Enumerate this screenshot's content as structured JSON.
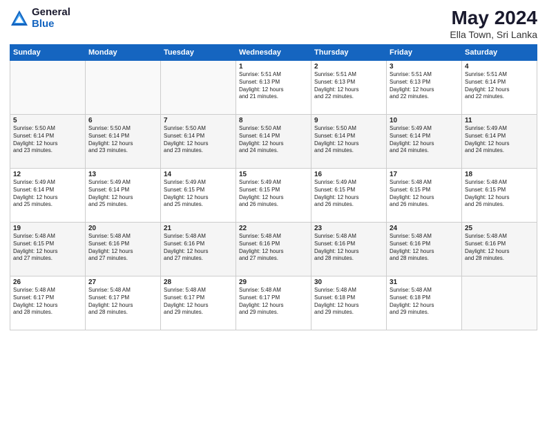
{
  "logo": {
    "general": "General",
    "blue": "Blue"
  },
  "title": "May 2024",
  "subtitle": "Ella Town, Sri Lanka",
  "header_days": [
    "Sunday",
    "Monday",
    "Tuesday",
    "Wednesday",
    "Thursday",
    "Friday",
    "Saturday"
  ],
  "weeks": [
    [
      {
        "day": "",
        "info": ""
      },
      {
        "day": "",
        "info": ""
      },
      {
        "day": "",
        "info": ""
      },
      {
        "day": "1",
        "info": "Sunrise: 5:51 AM\nSunset: 6:13 PM\nDaylight: 12 hours\nand 21 minutes."
      },
      {
        "day": "2",
        "info": "Sunrise: 5:51 AM\nSunset: 6:13 PM\nDaylight: 12 hours\nand 22 minutes."
      },
      {
        "day": "3",
        "info": "Sunrise: 5:51 AM\nSunset: 6:13 PM\nDaylight: 12 hours\nand 22 minutes."
      },
      {
        "day": "4",
        "info": "Sunrise: 5:51 AM\nSunset: 6:14 PM\nDaylight: 12 hours\nand 22 minutes."
      }
    ],
    [
      {
        "day": "5",
        "info": "Sunrise: 5:50 AM\nSunset: 6:14 PM\nDaylight: 12 hours\nand 23 minutes."
      },
      {
        "day": "6",
        "info": "Sunrise: 5:50 AM\nSunset: 6:14 PM\nDaylight: 12 hours\nand 23 minutes."
      },
      {
        "day": "7",
        "info": "Sunrise: 5:50 AM\nSunset: 6:14 PM\nDaylight: 12 hours\nand 23 minutes."
      },
      {
        "day": "8",
        "info": "Sunrise: 5:50 AM\nSunset: 6:14 PM\nDaylight: 12 hours\nand 24 minutes."
      },
      {
        "day": "9",
        "info": "Sunrise: 5:50 AM\nSunset: 6:14 PM\nDaylight: 12 hours\nand 24 minutes."
      },
      {
        "day": "10",
        "info": "Sunrise: 5:49 AM\nSunset: 6:14 PM\nDaylight: 12 hours\nand 24 minutes."
      },
      {
        "day": "11",
        "info": "Sunrise: 5:49 AM\nSunset: 6:14 PM\nDaylight: 12 hours\nand 24 minutes."
      }
    ],
    [
      {
        "day": "12",
        "info": "Sunrise: 5:49 AM\nSunset: 6:14 PM\nDaylight: 12 hours\nand 25 minutes."
      },
      {
        "day": "13",
        "info": "Sunrise: 5:49 AM\nSunset: 6:14 PM\nDaylight: 12 hours\nand 25 minutes."
      },
      {
        "day": "14",
        "info": "Sunrise: 5:49 AM\nSunset: 6:15 PM\nDaylight: 12 hours\nand 25 minutes."
      },
      {
        "day": "15",
        "info": "Sunrise: 5:49 AM\nSunset: 6:15 PM\nDaylight: 12 hours\nand 26 minutes."
      },
      {
        "day": "16",
        "info": "Sunrise: 5:49 AM\nSunset: 6:15 PM\nDaylight: 12 hours\nand 26 minutes."
      },
      {
        "day": "17",
        "info": "Sunrise: 5:48 AM\nSunset: 6:15 PM\nDaylight: 12 hours\nand 26 minutes."
      },
      {
        "day": "18",
        "info": "Sunrise: 5:48 AM\nSunset: 6:15 PM\nDaylight: 12 hours\nand 26 minutes."
      }
    ],
    [
      {
        "day": "19",
        "info": "Sunrise: 5:48 AM\nSunset: 6:15 PM\nDaylight: 12 hours\nand 27 minutes."
      },
      {
        "day": "20",
        "info": "Sunrise: 5:48 AM\nSunset: 6:16 PM\nDaylight: 12 hours\nand 27 minutes."
      },
      {
        "day": "21",
        "info": "Sunrise: 5:48 AM\nSunset: 6:16 PM\nDaylight: 12 hours\nand 27 minutes."
      },
      {
        "day": "22",
        "info": "Sunrise: 5:48 AM\nSunset: 6:16 PM\nDaylight: 12 hours\nand 27 minutes."
      },
      {
        "day": "23",
        "info": "Sunrise: 5:48 AM\nSunset: 6:16 PM\nDaylight: 12 hours\nand 28 minutes."
      },
      {
        "day": "24",
        "info": "Sunrise: 5:48 AM\nSunset: 6:16 PM\nDaylight: 12 hours\nand 28 minutes."
      },
      {
        "day": "25",
        "info": "Sunrise: 5:48 AM\nSunset: 6:16 PM\nDaylight: 12 hours\nand 28 minutes."
      }
    ],
    [
      {
        "day": "26",
        "info": "Sunrise: 5:48 AM\nSunset: 6:17 PM\nDaylight: 12 hours\nand 28 minutes."
      },
      {
        "day": "27",
        "info": "Sunrise: 5:48 AM\nSunset: 6:17 PM\nDaylight: 12 hours\nand 28 minutes."
      },
      {
        "day": "28",
        "info": "Sunrise: 5:48 AM\nSunset: 6:17 PM\nDaylight: 12 hours\nand 29 minutes."
      },
      {
        "day": "29",
        "info": "Sunrise: 5:48 AM\nSunset: 6:17 PM\nDaylight: 12 hours\nand 29 minutes."
      },
      {
        "day": "30",
        "info": "Sunrise: 5:48 AM\nSunset: 6:18 PM\nDaylight: 12 hours\nand 29 minutes."
      },
      {
        "day": "31",
        "info": "Sunrise: 5:48 AM\nSunset: 6:18 PM\nDaylight: 12 hours\nand 29 minutes."
      },
      {
        "day": "",
        "info": ""
      }
    ]
  ]
}
